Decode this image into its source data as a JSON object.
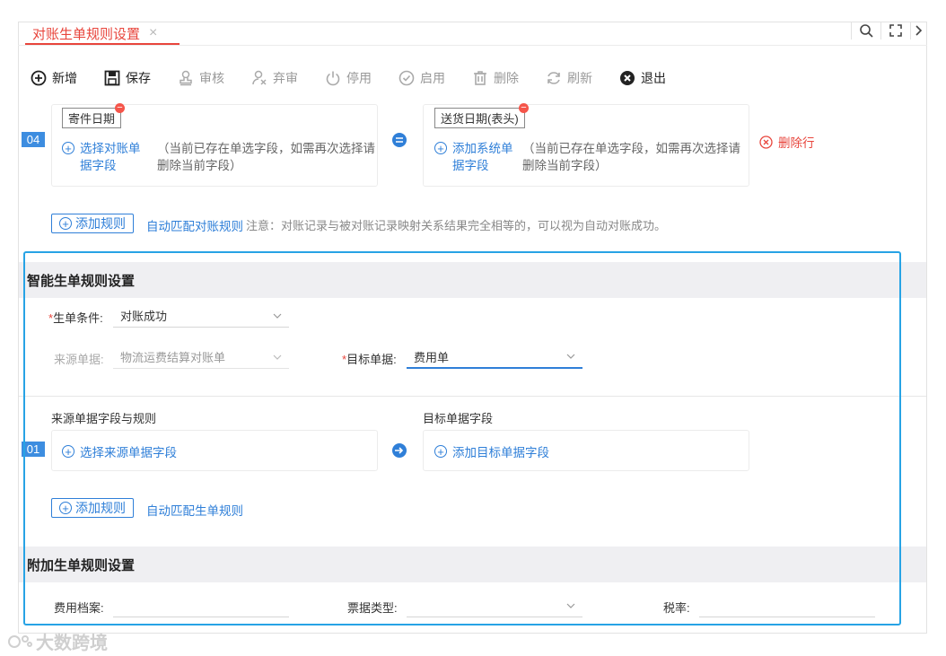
{
  "tab": {
    "title": "对账生单规则设置",
    "close": "×"
  },
  "toolbar": [
    {
      "label": "新增",
      "icon": "plus-circle-icon",
      "enabled": true
    },
    {
      "label": "保存",
      "icon": "save-icon",
      "enabled": true
    },
    {
      "label": "审核",
      "icon": "audit-stamp-icon",
      "enabled": false
    },
    {
      "label": "弃审",
      "icon": "unaudit-icon",
      "enabled": false
    },
    {
      "label": "停用",
      "icon": "power-icon",
      "enabled": false
    },
    {
      "label": "启用",
      "icon": "check-circle-icon",
      "enabled": false
    },
    {
      "label": "删除",
      "icon": "trash-icon",
      "enabled": false
    },
    {
      "label": "刷新",
      "icon": "refresh-icon",
      "enabled": false
    },
    {
      "label": "退出",
      "icon": "close-circle-icon",
      "enabled": true
    }
  ],
  "rule04": {
    "index": "04",
    "left_tag": "寄件日期",
    "left_link": [
      "选择对账单",
      "据字段"
    ],
    "left_hint": [
      "（当前已存在单选字段，如需再次选择请",
      "删除当前字段）"
    ],
    "right_tag": "送货日期(表头)",
    "right_link": [
      "添加系统单",
      "据字段"
    ],
    "right_hint": [
      "（当前已存在单选字段，如需再次选择请",
      "删除当前字段）"
    ],
    "delete_row": "删除行"
  },
  "reconcile_actions": {
    "add_rule": "添加规则",
    "auto_match": "自动匹配对账规则",
    "note": "注意：对账记录与被对账记录映射关系结果完全相等的，可以视为自动对账成功。"
  },
  "smart": {
    "header": "智能生单规则设置",
    "condition_label": "生单条件:",
    "condition_value": "对账成功",
    "source_label": "来源单据:",
    "source_value": "物流运费结算对账单",
    "target_label": "目标单据:",
    "target_value": "费用单",
    "source_fields_title": "来源单据字段与规则",
    "target_fields_title": "目标单据字段",
    "row_index": "01",
    "select_source": "选择来源单据字段",
    "add_target": "添加目标单据字段",
    "add_rule": "添加规则",
    "auto_match": "自动匹配生单规则"
  },
  "extra": {
    "header": "附加生单规则设置",
    "fee_label": "费用档案:",
    "ticket_label": "票据类型:",
    "tax_label": "税率:"
  },
  "watermark": "大数跨境",
  "colors": {
    "accent": "#2f7fd8",
    "tab_red": "#e8453c",
    "highlight": "#27a3e5",
    "badge_blue": "#3d8de0"
  }
}
